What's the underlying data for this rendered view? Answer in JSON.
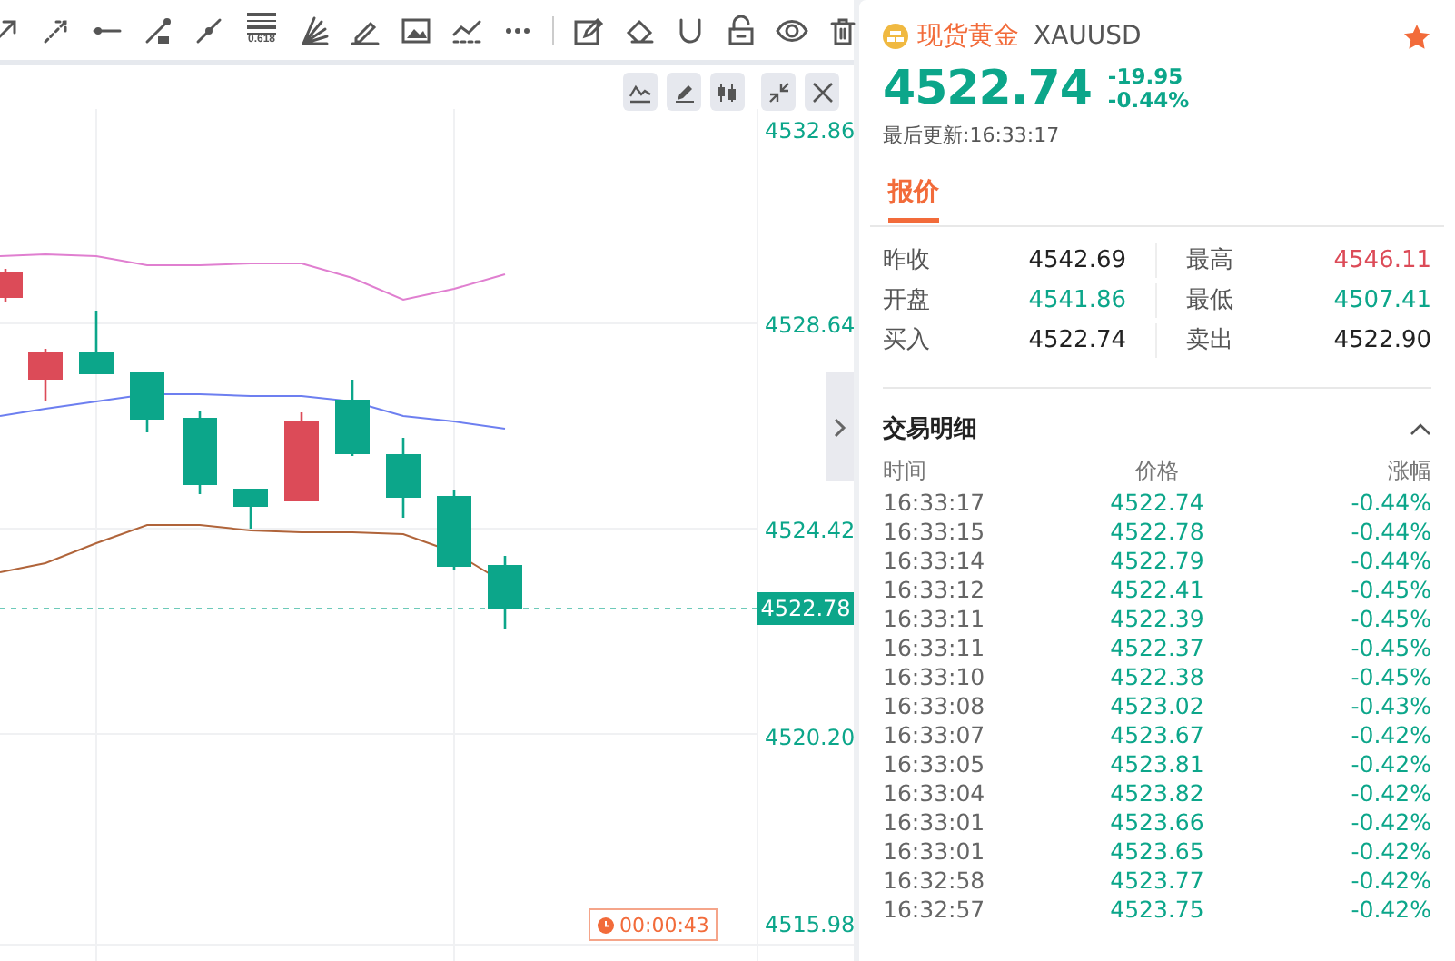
{
  "toolbar": {
    "fib_label": "0.618"
  },
  "chart": {
    "y_axis_labels": [
      "4532.86",
      "4528.64",
      "4524.42",
      "4520.20",
      "4515.98"
    ],
    "current_price": "4522.78",
    "countdown": "00:00:43"
  },
  "quote": {
    "name": "现货黄金",
    "symbol": "XAUUSD",
    "favorite": true,
    "price": "4522.74",
    "change": "-19.95",
    "change_percent": "-0.44%",
    "updated": "最后更新:16:33:17"
  },
  "tabs": [
    {
      "label": "报价",
      "selected": true
    }
  ],
  "stats": [
    {
      "label": "昨收",
      "value": "4542.69",
      "color": "#222222"
    },
    {
      "label": "最高",
      "value": "4546.11",
      "color": "#dc4b58"
    },
    {
      "label": "开盘",
      "value": "4541.86",
      "color": "#0ca68a"
    },
    {
      "label": "最低",
      "value": "4507.41",
      "color": "#0ca68a"
    },
    {
      "label": "买入",
      "value": "4522.74",
      "color": "#222222"
    },
    {
      "label": "卖出",
      "value": "4522.90",
      "color": "#222222"
    }
  ],
  "trades": {
    "title": "交易明细",
    "expanded": true,
    "columns": [
      "时间",
      "价格",
      "涨幅"
    ],
    "rows": [
      {
        "time": "16:33:17",
        "price": "4522.74",
        "change": "-0.44%"
      },
      {
        "time": "16:33:15",
        "price": "4522.78",
        "change": "-0.44%"
      },
      {
        "time": "16:33:14",
        "price": "4522.79",
        "change": "-0.44%"
      },
      {
        "time": "16:33:12",
        "price": "4522.41",
        "change": "-0.45%"
      },
      {
        "time": "16:33:11",
        "price": "4522.39",
        "change": "-0.45%"
      },
      {
        "time": "16:33:11",
        "price": "4522.37",
        "change": "-0.45%"
      },
      {
        "time": "16:33:10",
        "price": "4522.38",
        "change": "-0.45%"
      },
      {
        "time": "16:33:08",
        "price": "4523.02",
        "change": "-0.43%"
      },
      {
        "time": "16:33:07",
        "price": "4523.67",
        "change": "-0.42%"
      },
      {
        "time": "16:33:05",
        "price": "4523.81",
        "change": "-0.42%"
      },
      {
        "time": "16:33:04",
        "price": "4523.82",
        "change": "-0.42%"
      },
      {
        "time": "16:33:01",
        "price": "4523.66",
        "change": "-0.42%"
      },
      {
        "time": "16:33:01",
        "price": "4523.65",
        "change": "-0.42%"
      },
      {
        "time": "16:32:58",
        "price": "4523.77",
        "change": "-0.42%"
      },
      {
        "time": "16:32:57",
        "price": "4523.75",
        "change": "-0.42%"
      }
    ]
  }
}
